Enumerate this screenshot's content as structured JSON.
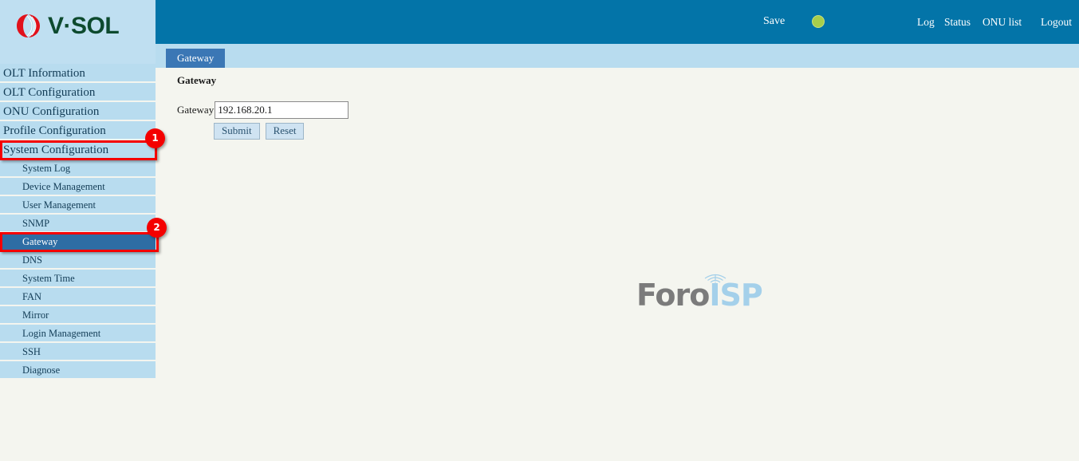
{
  "brand": {
    "name": "V·SOL",
    "logo_icon": "vsol-circular-logo-icon"
  },
  "header": {
    "save_label": "Save",
    "status_indicator": {
      "icon": "status-dot-icon",
      "color": "#a7ce4b"
    },
    "links": [
      {
        "label": "Log"
      },
      {
        "label": "Status"
      },
      {
        "label": "ONU list"
      },
      {
        "label": "Logout"
      }
    ],
    "background_color": "#0374a8"
  },
  "tabs": [
    {
      "label": "Gateway",
      "active": true
    }
  ],
  "sidebar": {
    "items": [
      {
        "label": "OLT Information",
        "level": "top",
        "active": false
      },
      {
        "label": "OLT Configuration",
        "level": "top",
        "active": false
      },
      {
        "label": "ONU Configuration",
        "level": "top",
        "active": false
      },
      {
        "label": "Profile Configuration",
        "level": "top",
        "active": false
      },
      {
        "label": "System Configuration",
        "level": "top",
        "active": false
      },
      {
        "label": "System Log",
        "level": "sub",
        "active": false
      },
      {
        "label": "Device Management",
        "level": "sub",
        "active": false
      },
      {
        "label": "User Management",
        "level": "sub",
        "active": false
      },
      {
        "label": "SNMP",
        "level": "sub",
        "active": false
      },
      {
        "label": "Gateway",
        "level": "sub",
        "active": true
      },
      {
        "label": "DNS",
        "level": "sub",
        "active": false
      },
      {
        "label": "System Time",
        "level": "sub",
        "active": false
      },
      {
        "label": "FAN",
        "level": "sub",
        "active": false
      },
      {
        "label": "Mirror",
        "level": "sub",
        "active": false
      },
      {
        "label": "Login Management",
        "level": "sub",
        "active": false
      },
      {
        "label": "SSH",
        "level": "sub",
        "active": false
      },
      {
        "label": "Diagnose",
        "level": "sub",
        "active": false
      }
    ],
    "item_background": "#b8dcef",
    "active_background": "#2e6da4"
  },
  "main": {
    "heading": "Gateway",
    "form": {
      "gateway_label": "Gateway",
      "gateway_value": "192.168.20.1",
      "gateway_placeholder": "",
      "submit_label": "Submit",
      "reset_label": "Reset"
    }
  },
  "watermark": {
    "text_primary": "Foro",
    "text_secondary": "ISP",
    "icon": "tower-signal-icon",
    "primary_color": "#7b7b7b",
    "secondary_color": "#a4d0ea"
  },
  "annotations": [
    {
      "number": "1",
      "target": "System Configuration",
      "color": "#f40000"
    },
    {
      "number": "2",
      "target": "Gateway",
      "color": "#f40000"
    }
  ]
}
